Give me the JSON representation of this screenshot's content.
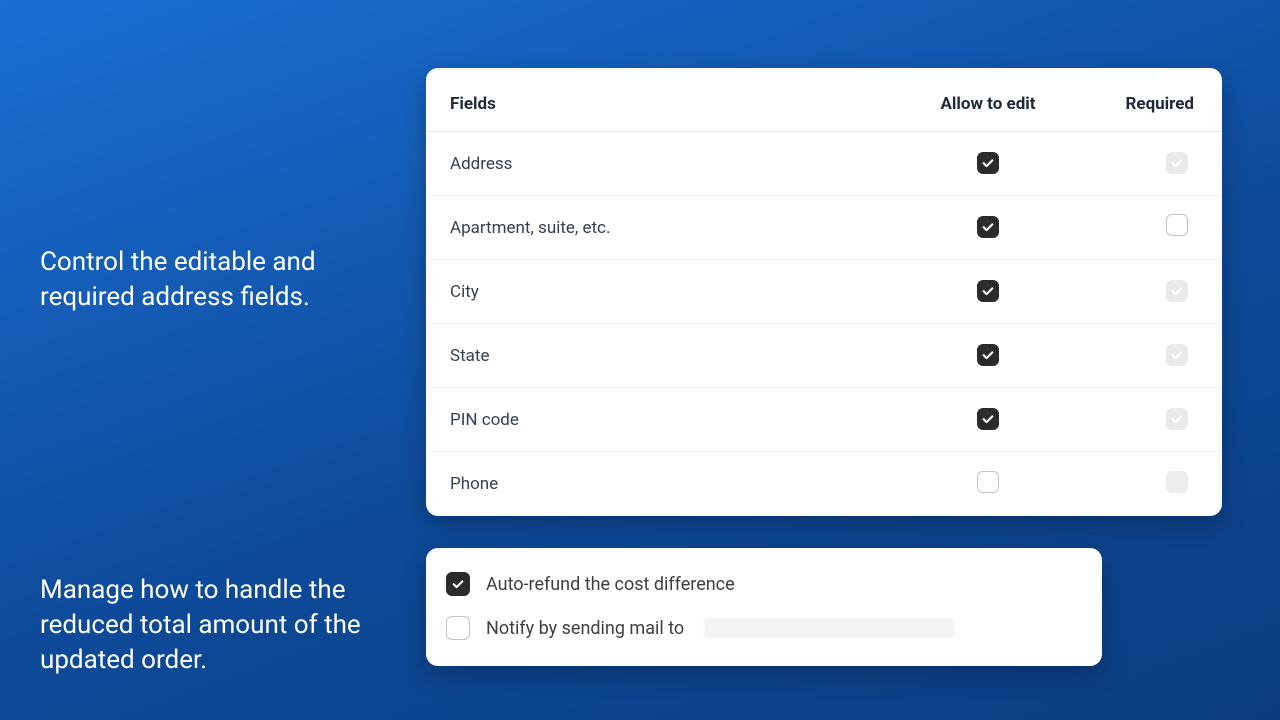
{
  "captions": {
    "fieldsControl": "Control the editable and required address fields.",
    "refundControl": "Manage how to handle the reduced total amount of the updated order."
  },
  "fieldsTable": {
    "headers": {
      "fields": "Fields",
      "allow": "Allow to edit",
      "required": "Required"
    },
    "rows": [
      {
        "label": "Address",
        "allow": true,
        "allowEnabled": true,
        "required": true,
        "requiredEnabled": false
      },
      {
        "label": "Apartment, suite, etc.",
        "allow": true,
        "allowEnabled": true,
        "required": false,
        "requiredEnabled": true
      },
      {
        "label": "City",
        "allow": true,
        "allowEnabled": true,
        "required": true,
        "requiredEnabled": false
      },
      {
        "label": "State",
        "allow": true,
        "allowEnabled": true,
        "required": true,
        "requiredEnabled": false
      },
      {
        "label": "PIN code",
        "allow": true,
        "allowEnabled": true,
        "required": true,
        "requiredEnabled": false
      },
      {
        "label": "Phone",
        "allow": false,
        "allowEnabled": true,
        "required": false,
        "requiredEnabled": false
      }
    ]
  },
  "refundOptions": {
    "autoRefund": {
      "label": "Auto-refund the cost difference",
      "checked": true
    },
    "notify": {
      "label": "Notify by sending mail to",
      "checked": false,
      "emailMasked": true
    }
  }
}
